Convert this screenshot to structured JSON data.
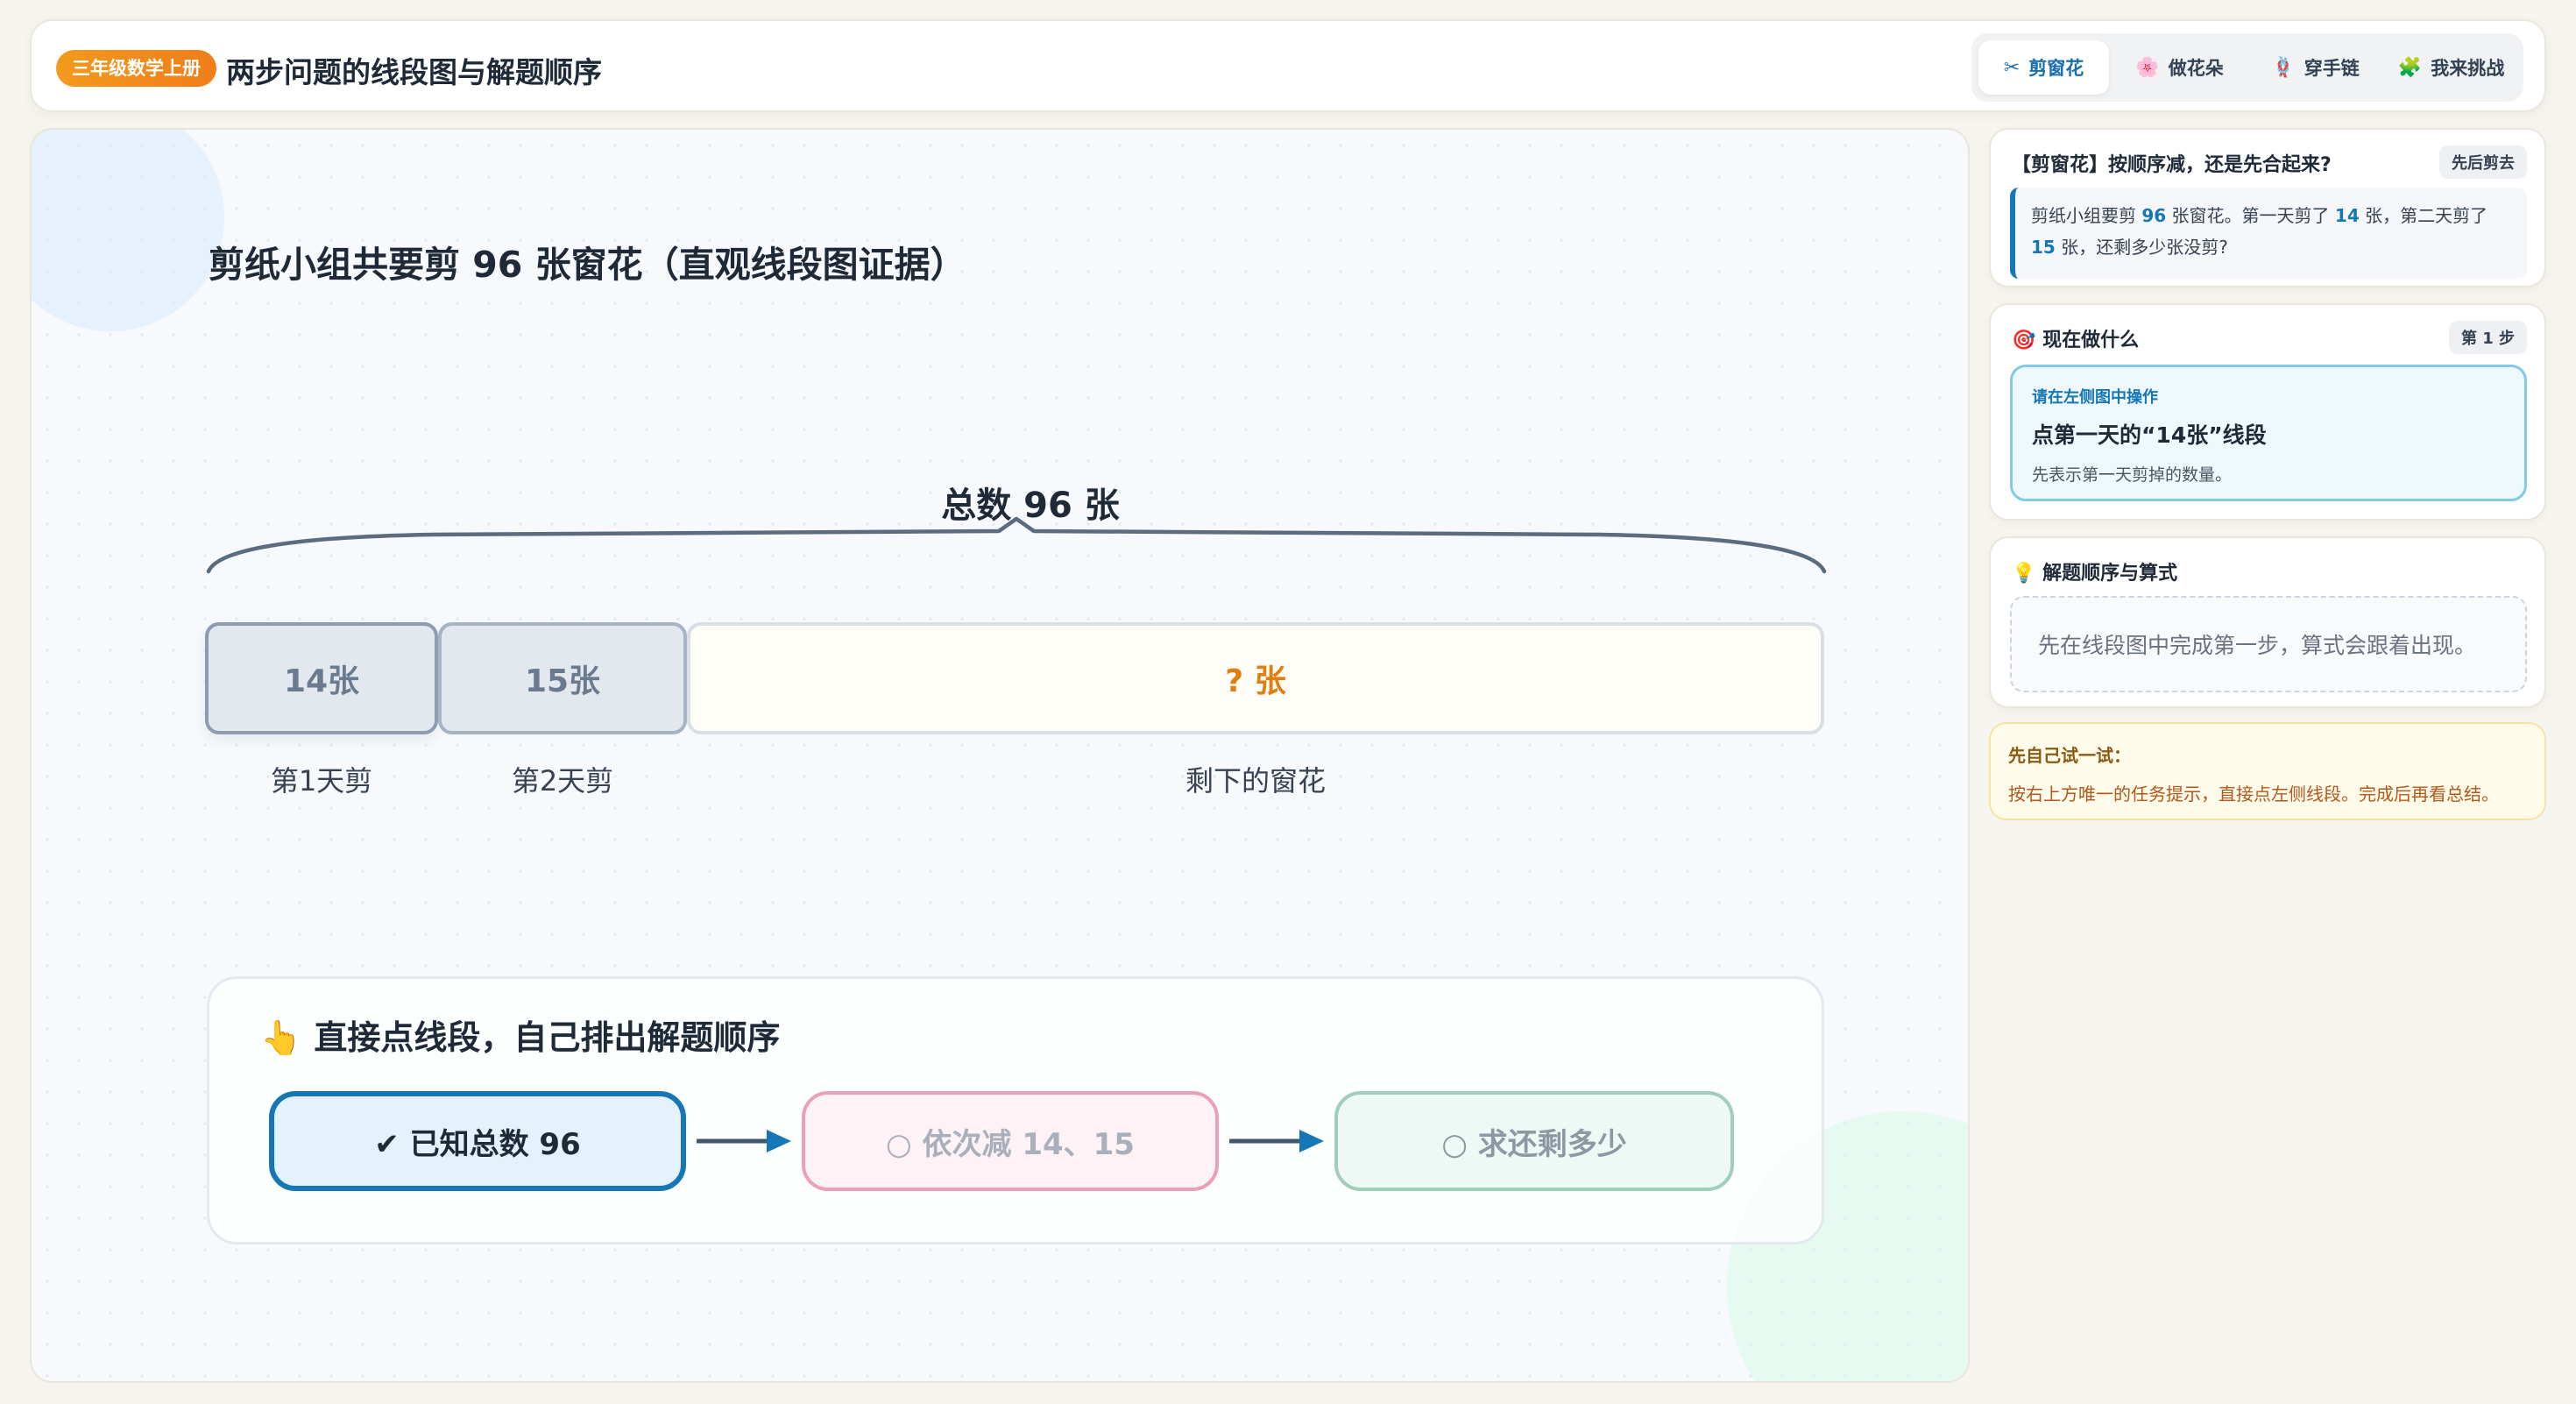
{
  "header": {
    "grade_badge": "三年级数学上册",
    "title": "两步问题的线段图与解题顺序",
    "tabs": [
      {
        "icon": "✂",
        "label": "剪窗花",
        "active": true
      },
      {
        "icon": "🌸",
        "label": "做花朵",
        "active": false
      },
      {
        "icon": "🪢",
        "label": "穿手链",
        "active": false
      },
      {
        "icon": "🧩",
        "label": "我来挑战",
        "active": false
      }
    ]
  },
  "main": {
    "heading": "剪纸小组共要剪 96 张窗花（直观线段图证据）",
    "total_label": "总数 96 张",
    "segments": [
      {
        "text": "14张",
        "caption": "第1天剪"
      },
      {
        "text": "15张",
        "caption": "第2天剪"
      },
      {
        "text": "? 张",
        "caption": "剩下的窗花"
      }
    ],
    "order": {
      "icon": "👆",
      "title": "直接点线段，自己排出解题顺序",
      "steps": [
        "✔ 已知总数 96",
        "○ 依次减 14、15",
        "○ 求还剩多少"
      ]
    }
  },
  "sidebar": {
    "problem": {
      "title": "【剪窗花】按顺序减，还是先合起来?",
      "badge": "先后剪去",
      "text_parts": [
        "剪纸小组要剪 ",
        "96",
        " 张窗花。第一天剪了 ",
        "14",
        " 张，第二天剪了 ",
        "15",
        " 张，还剩多少张没剪?"
      ]
    },
    "current": {
      "icon": "🎯",
      "title": "现在做什么",
      "badge": "第 1 步",
      "hint": "请在左侧图中操作",
      "main": "点第一天的“14张”线段",
      "sub": "先表示第一天剪掉的数量。"
    },
    "formula": {
      "icon": "💡",
      "title": "解题顺序与算式",
      "placeholder": "先在线段图中完成第一步，算式会跟着出现。"
    },
    "try": {
      "title": "先自己试一试：",
      "text": "按右上方唯一的任务提示，直接点左侧线段。完成后再看总结。"
    }
  },
  "colors": {
    "accent": "#1677b7",
    "badge_orange": "#f07d1a",
    "question_orange": "#e07e10"
  }
}
